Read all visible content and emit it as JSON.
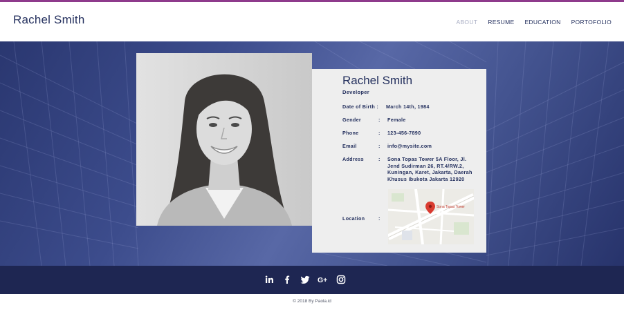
{
  "header": {
    "brand": "Rachel Smith",
    "nav": [
      "ABOUT",
      "RESUME",
      "EDUCATION",
      "PORTOFOLIO"
    ],
    "active_nav": "ABOUT"
  },
  "profile": {
    "name": "Rachel Smith",
    "role": "Developer",
    "fields": [
      {
        "label": "Date of Birth :",
        "separator": "",
        "value": "March 14th, 1984"
      },
      {
        "label": "Gender",
        "separator": ":",
        "value": "Female"
      },
      {
        "label": "Phone",
        "separator": ":",
        "value": "123-456-7890"
      },
      {
        "label": "Email",
        "separator": ":",
        "value": "info@mysite.com"
      },
      {
        "label": "Address",
        "separator": ":",
        "value": "Sona Topas Tower 5A Floor, Jl. Jend Sudirman 26, RT.4/RW.2, Kuningan, Karet, Jakarta, Daerah Khusus Ibukota Jakarta 12920"
      },
      {
        "label": "Location",
        "separator": ":",
        "value": ""
      }
    ],
    "map_place": "Sona Topas Tower"
  },
  "social": [
    "linkedin-icon",
    "facebook-icon",
    "twitter-icon",
    "google-plus-icon",
    "instagram-icon"
  ],
  "footer": {
    "copyright": "© 2018 By Paola.id"
  },
  "colors": {
    "accent_line": "#8e3a8c",
    "navy": "#24305e",
    "footer_bg": "#1e2652",
    "card_bg": "#eeeeee"
  }
}
